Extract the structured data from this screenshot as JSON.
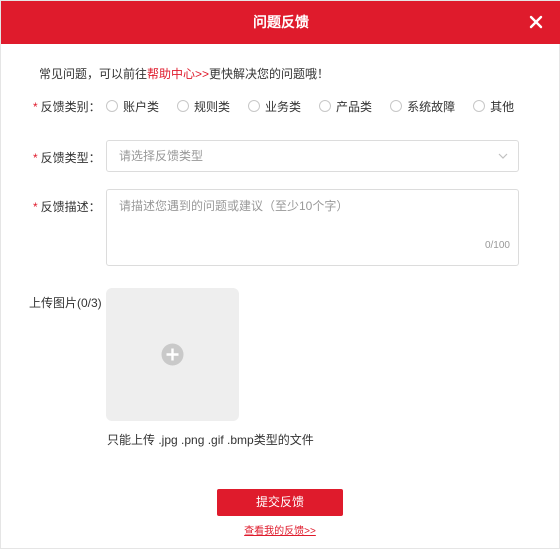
{
  "dialog": {
    "title": "问题反馈",
    "close_icon": "close-icon"
  },
  "tip": {
    "prefix": "常见问题，可以前往",
    "link": "帮助中心>>",
    "suffix": "更快解决您的问题哦！"
  },
  "feedback_category": {
    "required_mark": "*",
    "label": "反馈类别：",
    "options": [
      "账户类",
      "规则类",
      "业务类",
      "产品类",
      "系统故障",
      "其他"
    ]
  },
  "feedback_type": {
    "required_mark": "*",
    "label": "反馈类型：",
    "placeholder": "请选择反馈类型",
    "chevron_icon": "chevron-down-icon"
  },
  "feedback_desc": {
    "required_mark": "*",
    "label": "反馈描述：",
    "placeholder": "请描述您遇到的问题或建议（至少10个字）",
    "counter": "0/100"
  },
  "upload": {
    "label": "上传图片(0/3)",
    "icon": "plus-circle-icon",
    "hint": "只能上传 .jpg .png .gif .bmp类型的文件"
  },
  "actions": {
    "submit_label": "提交反馈",
    "view_link": "查看我的反馈>>"
  },
  "colors": {
    "brand": "#df1b2c",
    "placeholder": "#999999",
    "upload_bg": "#eeeeee"
  }
}
